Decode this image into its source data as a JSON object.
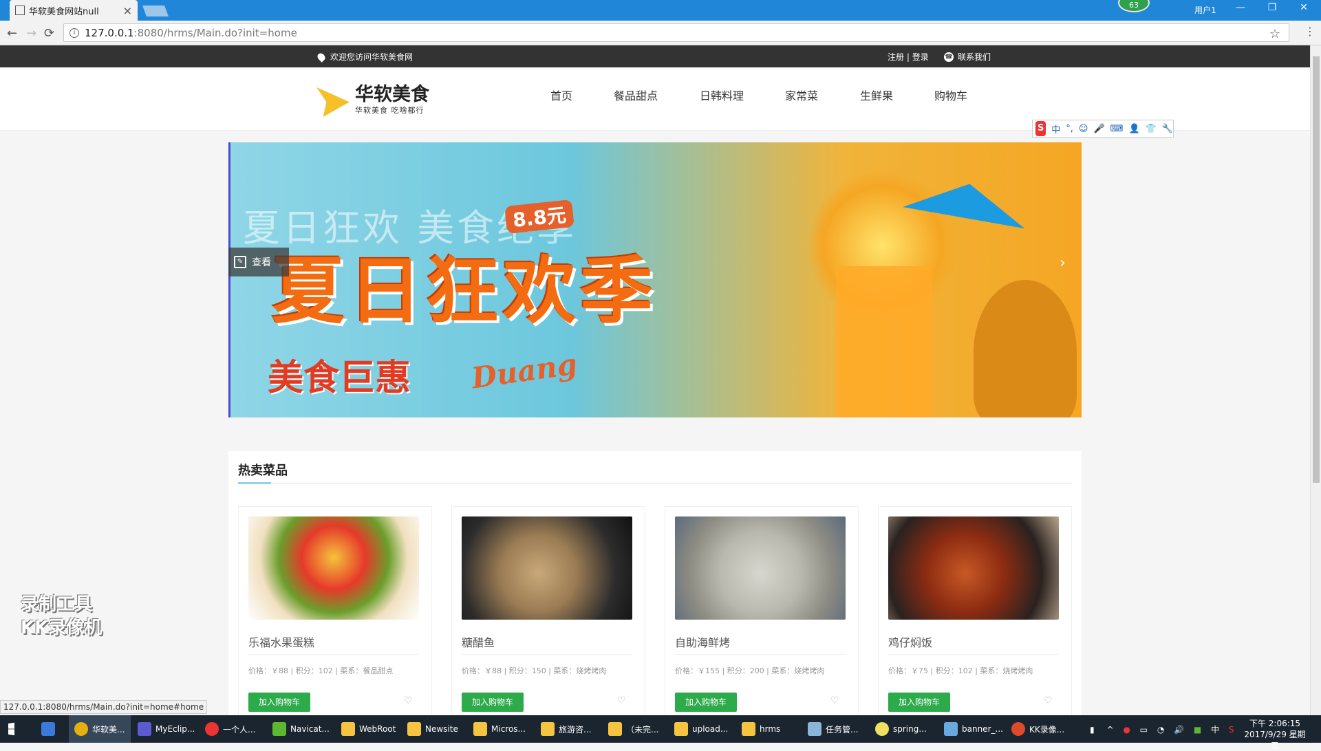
{
  "browser": {
    "tab_title": "华软美食网站null",
    "tab_close": "×",
    "url_host": "127.0.0.1",
    "url_path": ":8080/hrms/Main.do?init=home",
    "user_label": "用户1",
    "badge": "63",
    "status_url": "127.0.0.1:8080/hrms/Main.do?init=home#home"
  },
  "topbar": {
    "welcome": "欢迎您访问华软美食网",
    "register": "注册",
    "divider": "|",
    "login": "登录",
    "contact": "联系我们"
  },
  "header": {
    "logo_name": "华软美食",
    "logo_slogan": "华软美食 吃啥都行",
    "nav": [
      "首页",
      "餐品甜点",
      "日韩料理",
      "家常菜",
      "生鲜果",
      "购物车"
    ]
  },
  "ime": {
    "mode": "中"
  },
  "banner": {
    "ghost_text": "夏日狂欢   美食绝享",
    "badge": "8.8元",
    "title": "夏日狂欢季",
    "promo": "美食巨惠",
    "duang": "Duang",
    "view_button": "查看"
  },
  "hot": {
    "heading": "热卖菜品",
    "cart_label": "加入购物车",
    "items": [
      {
        "name": "乐福水果蛋糕",
        "meta": "价格：￥88 | 积分：102 | 菜系：餐品甜点"
      },
      {
        "name": "糖醋鱼",
        "meta": "价格：￥88 | 积分：150 | 菜系：烧烤烤肉"
      },
      {
        "name": "自助海鲜烤",
        "meta": "价格：￥155 | 积分：200 | 菜系：烧烤烤肉"
      },
      {
        "name": "鸡仔焖饭",
        "meta": "价格：￥75 | 积分：102 | 菜系：烧烤烤肉"
      }
    ]
  },
  "watermark": {
    "line1": "录制工具",
    "line2": "KK录像机"
  },
  "taskbar": {
    "items": [
      "华软美...",
      "MyEclip...",
      "一个人...",
      "Navicat...",
      "WebRoot",
      "Newsite",
      "Micros...",
      "旅游咨...",
      "（未完...",
      "upload...",
      "hrms",
      "任务管...",
      "spring...",
      "banner_...",
      "KK录像..."
    ],
    "ime_tray": "中",
    "time": "下午 2:06:15",
    "date": "2017/9/29 星期五"
  }
}
